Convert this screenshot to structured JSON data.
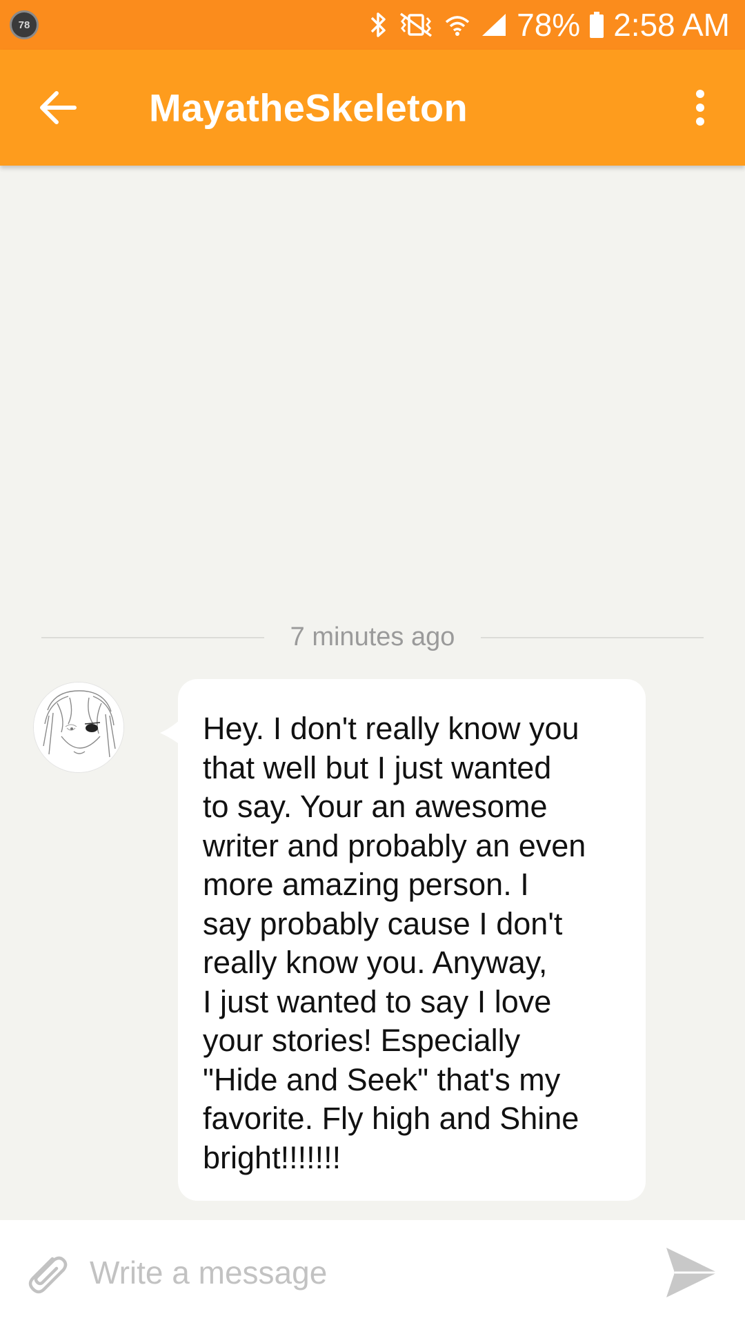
{
  "status_bar": {
    "notification_badge": "78",
    "battery_percent": "78%",
    "time": "2:58 AM",
    "icons": [
      "bluetooth-icon",
      "vibrate-icon",
      "wifi-icon",
      "signal-icon",
      "battery-icon"
    ]
  },
  "app_bar": {
    "title": "MayatheSkeleton",
    "back_icon": "arrow-left-icon",
    "menu_icon": "more-vertical-icon",
    "color": "#fe9c1d"
  },
  "chat": {
    "timestamp": "7 minutes ago",
    "messages": [
      {
        "sender_avatar": "anime-girl-sketch-avatar",
        "lines": [
          "Hey. I don't really know you",
          "that well but I just wanted",
          "to say. Your an awesome",
          "writer and probably an even",
          "more amazing person. I",
          "say probably cause I don't",
          "really know you. Anyway,",
          "I just wanted to say I love",
          "your stories! Especially",
          "\"Hide and Seek\" that's my",
          "favorite. Fly high and Shine",
          "bright!!!!!!!"
        ]
      }
    ]
  },
  "composer": {
    "placeholder": "Write a message",
    "value": "",
    "attach_icon": "paperclip-icon",
    "send_icon": "send-icon"
  }
}
